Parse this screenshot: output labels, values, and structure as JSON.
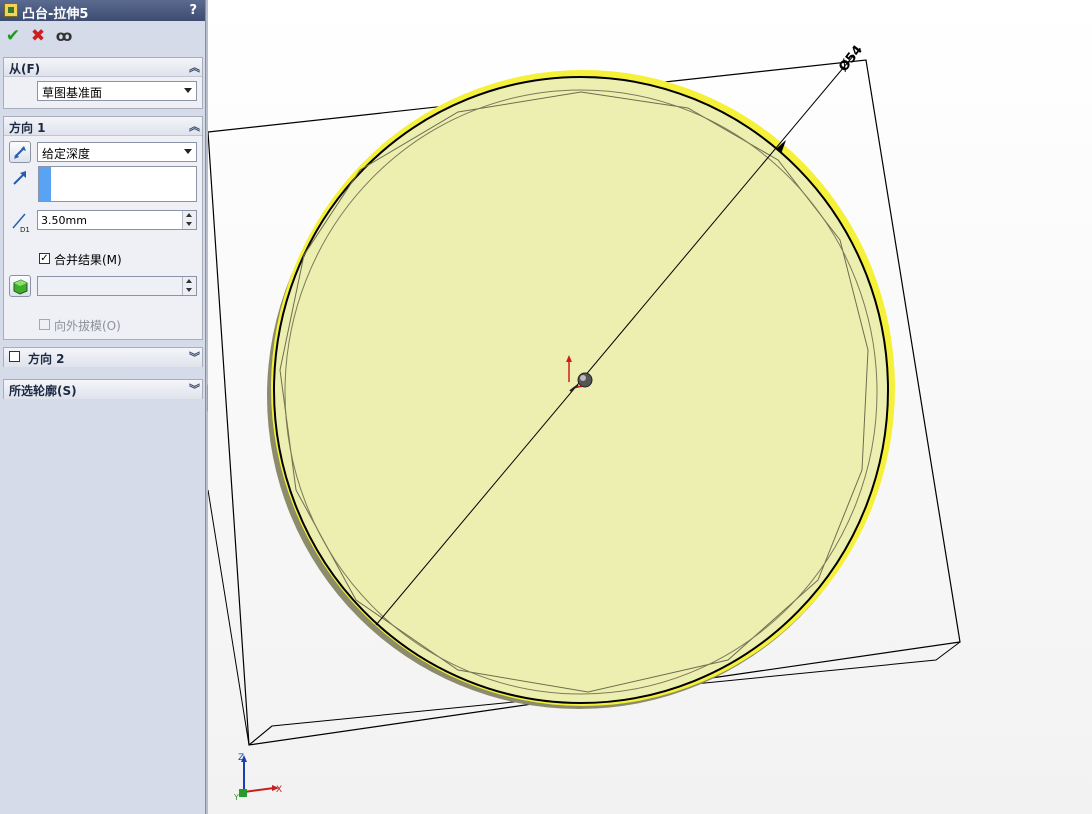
{
  "panel": {
    "title": "凸台-拉伸5",
    "help": "?",
    "actions": {
      "ok": "✔",
      "cancel": "✖",
      "preview": "ꝏ"
    },
    "from": {
      "header": "从(F)",
      "dropdown": "草图基准面"
    },
    "direction1": {
      "header": "方向 1",
      "end_condition": "给定深度",
      "depth": "3.50mm",
      "merge_label": "合并结果(M)",
      "merge_checked": true,
      "draft_label": "向外拔模(O)",
      "draft_checked": false
    },
    "direction2": {
      "header": "方向 2",
      "checked": false
    },
    "contours": {
      "header": "所选轮廓(S)"
    }
  },
  "viewport": {
    "dimension_label": "Ø54",
    "triad": {
      "x": "X",
      "y": "Y",
      "z": "Z"
    },
    "colors": {
      "preview_fill": "#ecefb0",
      "highlight": "#f5f03a",
      "edges": "#000000"
    }
  }
}
